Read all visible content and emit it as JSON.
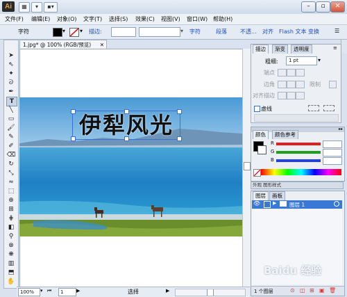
{
  "app": {
    "logo": "Ai"
  },
  "menu": [
    "文件(F)",
    "编辑(E)",
    "对象(O)",
    "文字(T)",
    "选择(S)",
    "效果(C)",
    "视图(V)",
    "窗口(W)",
    "帮助(H)"
  ],
  "control_bar": {
    "type_label": "字符",
    "stroke_label": "描边:",
    "char_link": "字符",
    "para_link": "段落",
    "opacity_link": "不透...",
    "align_link": "对齐",
    "flash_link": "Flash 文本",
    "transform_link": "变换"
  },
  "document": {
    "tab_title": "1.jpg* @ 100% (RGB/预览)",
    "headline": "伊犁风光"
  },
  "status": {
    "zoom": "100%",
    "page": "1",
    "tool": "选择"
  },
  "stroke_panel": {
    "tabs": [
      "描边",
      "渐变",
      "透明度"
    ],
    "weight_label": "粗细:",
    "weight_value": "1 pt",
    "cap_label": "端点",
    "join_label": "边角",
    "limit_label": "限制",
    "align_label": "对齐描边",
    "dashed_label": "虚线"
  },
  "color_panel": {
    "tabs": [
      "颜色",
      "颜色参考"
    ],
    "channels": [
      {
        "name": "R",
        "value": "",
        "color": "#e02020"
      },
      {
        "name": "G",
        "value": "",
        "color": "#20a020"
      },
      {
        "name": "B",
        "value": "",
        "color": "#2040e0"
      }
    ]
  },
  "layers_panel": {
    "tabs": [
      "图层",
      "画板"
    ],
    "layer_name": "图层 1",
    "collapsed_tabs": "外观  图形样式",
    "footer": "1 个图层"
  },
  "watermark": "Baidu 经验"
}
